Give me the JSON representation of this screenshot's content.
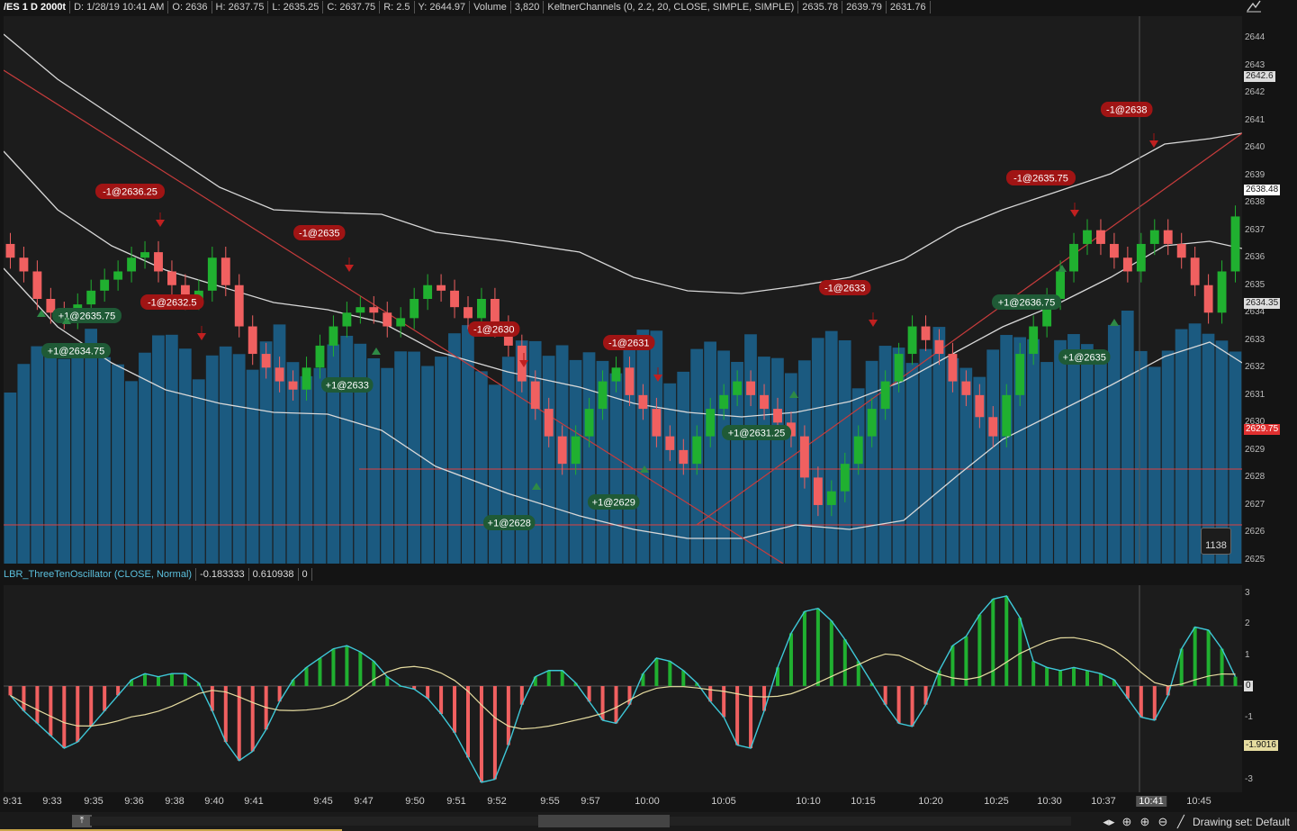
{
  "header": {
    "symbol": "/ES 1 D 2000t",
    "date": "D: 1/28/19 10:41 AM",
    "open": "O: 2636",
    "high": "H: 2637.75",
    "low": "L: 2635.25",
    "close": "C: 2637.75",
    "range": "R: 2.5",
    "y": "Y: 2644.97",
    "volume_label": "Volume",
    "volume_value": "3,820",
    "keltner_label": "KeltnerChannels (0, 2.2, 20, CLOSE, SIMPLE, SIMPLE)",
    "keltner_v1": "2635.78",
    "keltner_v2": "2639.79",
    "keltner_v3": "2631.76"
  },
  "study": {
    "name": "LBR_ThreeTenOscillator (CLOSE, Normal)",
    "v1": "-0.183333",
    "v2": "0.610938",
    "v3": "0"
  },
  "price_axis": {
    "ticks": [
      "2644",
      "2643",
      "2642",
      "2641",
      "2640",
      "2639",
      "2638",
      "2637",
      "2636",
      "2635",
      "2634",
      "2633",
      "2632",
      "2631",
      "2630",
      "2629",
      "2628",
      "2627",
      "2626",
      "2625"
    ],
    "tag_last": "2642.6",
    "tag_upper": "2638.48",
    "tag_mid": "2634.35",
    "tag_low": "2629.75"
  },
  "osc_axis": {
    "ticks": [
      "3",
      "2",
      "1",
      "0",
      "-1",
      "-2",
      "-3"
    ],
    "tag_value": "-1.9016",
    "tag_zero": "0"
  },
  "time_axis": [
    "9:31",
    "9:33",
    "9:35",
    "9:36",
    "9:38",
    "9:40",
    "9:41",
    "9:45",
    "9:47",
    "9:50",
    "9:51",
    "9:52",
    "9:55",
    "9:57",
    "10:00",
    "10:05",
    "10:10",
    "10:15",
    "10:20",
    "10:25",
    "10:30",
    "10:37",
    "10:41",
    "10:45"
  ],
  "time_axis_highlight": "10:41",
  "volume_badge": "1138",
  "trades": [
    {
      "label": "-1@2636.25",
      "side": "sell"
    },
    {
      "label": "-1@2632.5",
      "side": "sell"
    },
    {
      "label": "-1@2635",
      "side": "sell"
    },
    {
      "label": "-1@2630",
      "side": "sell"
    },
    {
      "label": "-1@2631",
      "side": "sell"
    },
    {
      "label": "-1@2633",
      "side": "sell"
    },
    {
      "label": "-1@2635.75",
      "side": "sell"
    },
    {
      "label": "-1@2638",
      "side": "sell"
    },
    {
      "label": "+1@2635.75",
      "side": "buy"
    },
    {
      "label": "+1@2634.75",
      "side": "buy"
    },
    {
      "label": "+1@2633",
      "side": "buy"
    },
    {
      "label": "+1@2628",
      "side": "buy"
    },
    {
      "label": "+1@2629",
      "side": "buy"
    },
    {
      "label": "+1@2631.25",
      "side": "buy"
    },
    {
      "label": "+1@2636.75",
      "side": "buy"
    },
    {
      "label": "+1@2635",
      "side": "buy"
    }
  ],
  "footer": {
    "drawing_set": "Drawing set: Default"
  },
  "colors": {
    "up": "#20b030",
    "down": "#f06060",
    "volume": "#1b5a80",
    "band": "#d8d8d8",
    "trend": "#c83c3c",
    "osc_line": "#3ec8d8",
    "osc_slow": "#e6dca0",
    "buy_bubble": "#1f5a36",
    "sell_bubble": "#a01414"
  }
}
